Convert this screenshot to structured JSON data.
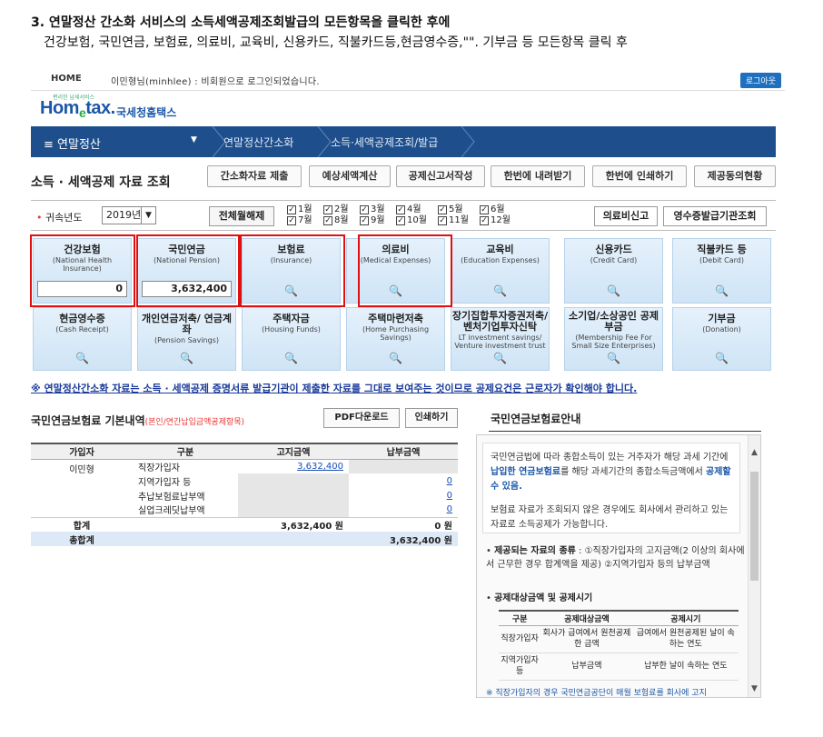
{
  "heading": "3. 연말정산 간소화 서비스의 소득세액공제조회발급의 모든항목을 클릭한 후에",
  "subheading": "건강보험, 국민연금, 보험료, 의료비, 교육비, 신용카드, 직불카드등,현금영수증,\"\". 기부금 등 모든항목 클릭 후",
  "topbar": {
    "home": "HOME",
    "welcome": "이민형님(minhlee) : 비회원으로 로그인되었습니다.",
    "logout": "로그아웃"
  },
  "logo": {
    "small": "편리한 납세서비스",
    "main_a": "Hom",
    "main_e": "e",
    "main_b": "tax.",
    "kr": "국세청홈택스"
  },
  "navbar": {
    "menu": "≡  연말정산",
    "caret": "▼",
    "crumb1": "연말정산간소화",
    "crumb2": "소득·세액공제조회/발급"
  },
  "page_title": "소득 · 세액공제 자료 조회",
  "toolbar": [
    "간소화자료 제출",
    "예상세액계산",
    "공제신고서작성",
    "한번에 내려받기",
    "한번에 인쇄하기",
    "제공동의현황"
  ],
  "filter": {
    "label_req": "•",
    "label": " 귀속년도",
    "year": "2019년",
    "year_dd": "▼",
    "all_btn": "전체월해제",
    "months_top": [
      "1월",
      "2월",
      "3월",
      "4월",
      "5월",
      "6월"
    ],
    "months_bottom": [
      "7월",
      "8월",
      "9월",
      "10월",
      "11월",
      "12월"
    ],
    "check": "✓",
    "btn_medical": "의료비신고",
    "btn_receipt": "영수증발급기관조회"
  },
  "tiles": [
    {
      "title": "건강보험",
      "en": "(National Health Insurance)",
      "value": "0"
    },
    {
      "title": "국민연금",
      "en": "(National Pension)",
      "value": "3,632,400"
    },
    {
      "title": "보험료",
      "en": "(Insurance)",
      "icon": "🔍"
    },
    {
      "title": "의료비",
      "en": "(Medical Expenses)",
      "icon": "🔍"
    },
    {
      "title": "교육비",
      "en": "(Education Expenses)",
      "icon": "🔍"
    },
    {
      "title": "신용카드",
      "en": "(Credit Card)",
      "icon": "🔍"
    },
    {
      "title": "직불카드 등",
      "en": "(Debit Card)",
      "icon": "🔍"
    },
    {
      "title": "현금영수증",
      "en": "(Cash Receipt)",
      "icon": "🔍"
    },
    {
      "title": "개인연금저축/ 연금계좌",
      "en": "(Pension Savings)",
      "icon": "🔍"
    },
    {
      "title": "주택자금",
      "en": "(Housing Funds)",
      "icon": "🔍"
    },
    {
      "title": "주택마련저축",
      "en": "(Home Purchasing Savings)",
      "icon": "🔍"
    },
    {
      "title": "장기집합투자증권저축/ 벤처기업투자신탁",
      "en": "LT investment savings/ Venture investment trust",
      "icon": "🔍"
    },
    {
      "title": "소기업/소상공인 공제부금",
      "en": "(Membership Fee For Small Size Enterprises)",
      "icon": "🔍"
    },
    {
      "title": "기부금",
      "en": "(Donation)",
      "icon": "🔍"
    }
  ],
  "notice": "※ 연말정산간소화 자료는 소득 · 세액공제 증명서류 발급기관이 제출한 자료를 그대로 보여주는 것이므로 공제요건은 근로자가 확인해야 합니다.",
  "pension_panel": {
    "title": "국민연금보험료 기본내역",
    "title_sub": "(본인/연간납입금액공제항목)",
    "pdf_btn": "PDF다운로드",
    "print_btn": "인쇄하기",
    "headers": [
      "가입자",
      "구분",
      "고지금액",
      "납부금액"
    ],
    "subscriber": "이민형",
    "rows": [
      {
        "type": "직장가입자",
        "notice": "3,632,400",
        "paid": ""
      },
      {
        "type": "지역가입자 등",
        "notice": "",
        "paid": "0"
      },
      {
        "type": "추납보험료납부액",
        "notice": "",
        "paid": "0"
      },
      {
        "type": "실업크레딧납부액",
        "notice": "",
        "paid": "0"
      }
    ],
    "sum_label": "합계",
    "sum_notice": "3,632,400 원",
    "sum_paid": "0 원",
    "total_label": "총합계",
    "total_paid": "3,632,400 원"
  },
  "guide": {
    "title": "국민연금보험료안내",
    "p1a": "국민연금법에 따라 종합소득이 있는 거주자가 해당 과세 기간에 ",
    "p1b": "납입한 연금보험료",
    "p1c": "를 해당 과세기간의 종합소득금액에서 ",
    "p1d": "공제할 수 있음.",
    "p2": "보험료 자료가 조회되지 않은 경우에도 회사에서 관리하고 있는 자료로 소득공제가 가능합니다.",
    "s1_label": "제공되는 자료의 종류",
    "s1_text": " : ①직장가입자의 고지금액(2 이상의 회사에서 근무한 경우 합계액을 제공) ②지역가입자 등의 납부금액",
    "s2_label": "공제대상금액 및 공제시기",
    "table_headers": [
      "구분",
      "공제대상금액",
      "공제시기"
    ],
    "table_rows": [
      [
        "직장가입자",
        "회사가 급여에서 원천공제한 금액",
        "급여에서 원천공제된 날이 속하는 연도"
      ],
      [
        "지역가입자 등",
        "납부금액",
        "납부한 날이 속하는 연도"
      ]
    ],
    "footnote": "※ 직장가입자의 경우 국민연금공단이 매월 보험료를 회사에 고지",
    "scroll_up": "▲",
    "scroll_down": "▼"
  }
}
